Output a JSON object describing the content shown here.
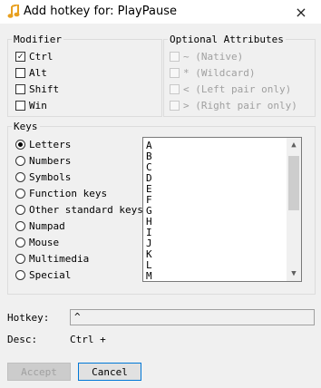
{
  "window": {
    "title": "Add hotkey for: PlayPause",
    "close": "×"
  },
  "modifier": {
    "legend": "Modifier",
    "items": [
      {
        "label": "Ctrl",
        "checked": true
      },
      {
        "label": "Alt",
        "checked": false
      },
      {
        "label": "Shift",
        "checked": false
      },
      {
        "label": "Win",
        "checked": false
      }
    ]
  },
  "optional": {
    "legend": "Optional Attributes",
    "items": [
      {
        "label": "~ (Native)"
      },
      {
        "label": "* (Wildcard)"
      },
      {
        "label": "< (Left pair only)"
      },
      {
        "label": "> (Right pair only)"
      }
    ]
  },
  "keys": {
    "legend": "Keys",
    "radios": [
      {
        "label": "Letters",
        "selected": true
      },
      {
        "label": "Numbers",
        "selected": false
      },
      {
        "label": "Symbols",
        "selected": false
      },
      {
        "label": "Function keys",
        "selected": false
      },
      {
        "label": "Other standard keys",
        "selected": false
      },
      {
        "label": "Numpad",
        "selected": false
      },
      {
        "label": "Mouse",
        "selected": false
      },
      {
        "label": "Multimedia",
        "selected": false
      },
      {
        "label": "Special",
        "selected": false
      }
    ],
    "list": [
      "A",
      "B",
      "C",
      "D",
      "E",
      "F",
      "G",
      "H",
      "I",
      "J",
      "K",
      "L",
      "M"
    ]
  },
  "hotkey": {
    "label": "Hotkey:",
    "value": "^"
  },
  "desc": {
    "label": "Desc:",
    "value": "Ctrl +"
  },
  "buttons": {
    "accept": "Accept",
    "cancel": "Cancel"
  },
  "icons": {
    "app": "music-note-icon",
    "check": "✓",
    "scroll_up": "▲",
    "scroll_down": "▼"
  }
}
